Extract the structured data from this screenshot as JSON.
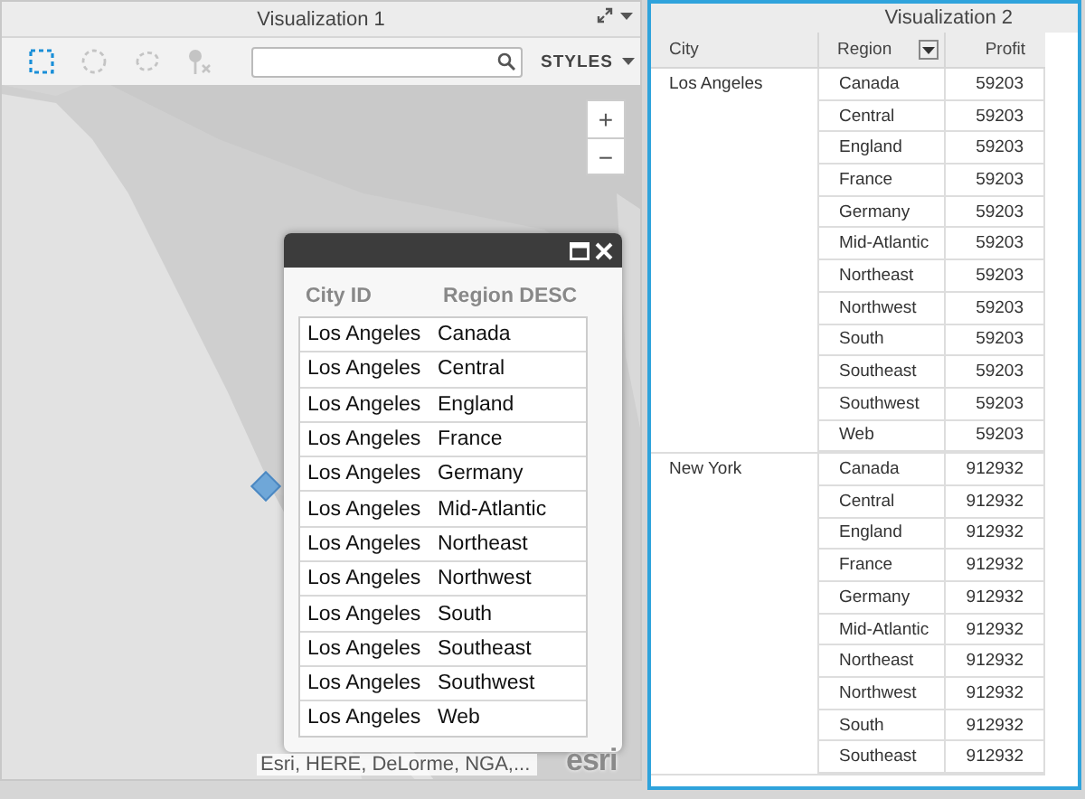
{
  "visualization_1": {
    "title": "Visualization 1",
    "tools": [
      {
        "kind": "rectangle",
        "selected": true
      },
      {
        "kind": "circle",
        "selected": false
      },
      {
        "kind": "lasso",
        "selected": false
      },
      {
        "kind": "clear",
        "selected": false
      }
    ],
    "styles_label": "STYLES",
    "zoom_buttons": [
      "+",
      "−"
    ],
    "popup": {
      "columns": [
        "City ID",
        "Region DESC"
      ],
      "rows": [
        [
          "Los Angeles",
          "Canada"
        ],
        [
          "Los Angeles",
          "Central"
        ],
        [
          "Los Angeles",
          "England"
        ],
        [
          "Los Angeles",
          "France"
        ],
        [
          "Los Angeles",
          "Germany"
        ],
        [
          "Los Angeles",
          "Mid-Atlantic"
        ],
        [
          "Los Angeles",
          "Northeast"
        ],
        [
          "Los Angeles",
          "Northwest"
        ],
        [
          "Los Angeles",
          "South"
        ],
        [
          "Los Angeles",
          "Southeast"
        ],
        [
          "Los Angeles",
          "Southwest"
        ],
        [
          "Los Angeles",
          "Web"
        ]
      ]
    },
    "attribution": "Esri, HERE, DeLorme, NGA,...",
    "logo": "esri"
  },
  "visualization_2": {
    "title": "Visualization 2",
    "columns": [
      "City",
      "Region",
      "Profit"
    ],
    "groups": [
      {
        "city": "Los Angeles",
        "rows": [
          {
            "region": "Canada",
            "profit": "59203"
          },
          {
            "region": "Central",
            "profit": "59203"
          },
          {
            "region": "England",
            "profit": "59203"
          },
          {
            "region": "France",
            "profit": "59203"
          },
          {
            "region": "Germany",
            "profit": "59203"
          },
          {
            "region": "Mid-Atlantic",
            "profit": "59203"
          },
          {
            "region": "Northeast",
            "profit": "59203"
          },
          {
            "region": "Northwest",
            "profit": "59203"
          },
          {
            "region": "South",
            "profit": "59203"
          },
          {
            "region": "Southeast",
            "profit": "59203"
          },
          {
            "region": "Southwest",
            "profit": "59203"
          },
          {
            "region": "Web",
            "profit": "59203"
          }
        ]
      },
      {
        "city": "New York",
        "rows": [
          {
            "region": "Canada",
            "profit": "912932"
          },
          {
            "region": "Central",
            "profit": "912932"
          },
          {
            "region": "England",
            "profit": "912932"
          },
          {
            "region": "France",
            "profit": "912932"
          },
          {
            "region": "Germany",
            "profit": "912932"
          },
          {
            "region": "Mid-Atlantic",
            "profit": "912932"
          },
          {
            "region": "Northeast",
            "profit": "912932"
          },
          {
            "region": "Northwest",
            "profit": "912932"
          },
          {
            "region": "South",
            "profit": "912932"
          },
          {
            "region": "Southeast",
            "profit": "912932"
          }
        ]
      }
    ]
  }
}
